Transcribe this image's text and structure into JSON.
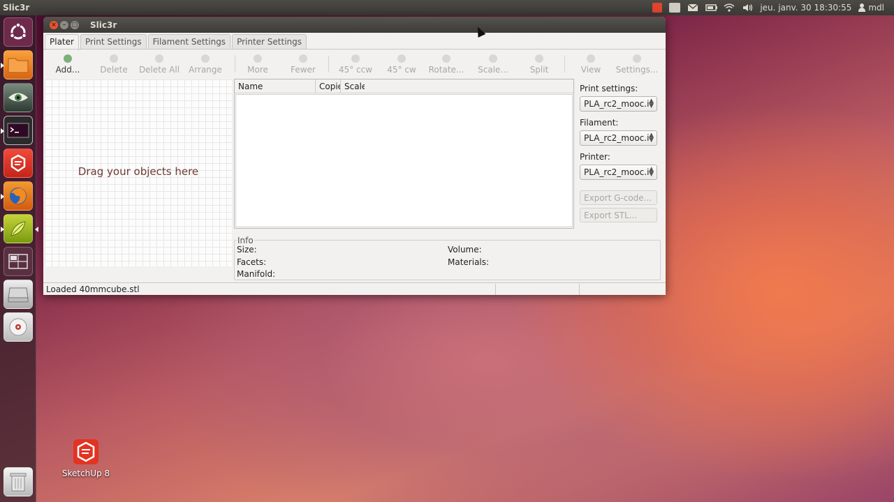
{
  "top_panel": {
    "app_name": "Slic3r",
    "clock": "jeu. janv. 30 18:30:55",
    "user": "mdl",
    "indicator_icons": [
      "session-indicator-icon",
      "printer-icon",
      "mail-icon",
      "battery-icon",
      "wifi-icon",
      "volume-icon"
    ]
  },
  "launcher": {
    "items": [
      {
        "name": "dash-home",
        "icon": "ubuntu-logo-icon"
      },
      {
        "name": "files",
        "icon": "folder-icon"
      },
      {
        "name": "image-viewer",
        "icon": "eye-icon"
      },
      {
        "name": "terminal",
        "icon": "terminal-icon"
      },
      {
        "name": "sketchup",
        "icon": "sketchup-icon"
      },
      {
        "name": "firefox",
        "icon": "firefox-icon"
      },
      {
        "name": "slic3r",
        "icon": "slic3r-icon"
      },
      {
        "name": "workspace-switcher",
        "icon": "workspace-icon"
      },
      {
        "name": "drive",
        "icon": "drive-icon"
      },
      {
        "name": "cd-drive",
        "icon": "disc-icon"
      },
      {
        "name": "trash",
        "icon": "trash-icon"
      }
    ]
  },
  "window": {
    "title": "Slic3r",
    "tabs": [
      {
        "label": "Plater",
        "active": true
      },
      {
        "label": "Print Settings",
        "active": false
      },
      {
        "label": "Filament Settings",
        "active": false
      },
      {
        "label": "Printer Settings",
        "active": false
      }
    ],
    "toolbar": {
      "add": "Add...",
      "delete": "Delete",
      "delete_all": "Delete All",
      "arrange": "Arrange",
      "more": "More",
      "fewer": "Fewer",
      "rotate_ccw": "45° ccw",
      "rotate_cw": "45° cw",
      "rotate": "Rotate...",
      "scale": "Scale...",
      "split": "Split",
      "view": "View",
      "settings": "Settings..."
    },
    "plater": {
      "drag_hint": "Drag your objects here"
    },
    "object_list": {
      "columns": [
        "Name",
        "Copie",
        "Scale"
      ]
    },
    "right_panel": {
      "print_settings_label": "Print settings:",
      "print_settings_value": "PLA_rc2_mooc.i",
      "filament_label": "Filament:",
      "filament_value": "PLA_rc2_mooc.i",
      "printer_label": "Printer:",
      "printer_value": "PLA_rc2_mooc.i",
      "export_gcode": "Export G-code...",
      "export_stl": "Export STL..."
    },
    "info": {
      "legend": "Info",
      "size": "Size:",
      "facets": "Facets:",
      "manifold": "Manifold:",
      "volume": "Volume:",
      "materials": "Materials:"
    },
    "status": "Loaded 40mmcube.stl"
  },
  "desktop": {
    "sketchup_label": "SketchUp 8"
  }
}
